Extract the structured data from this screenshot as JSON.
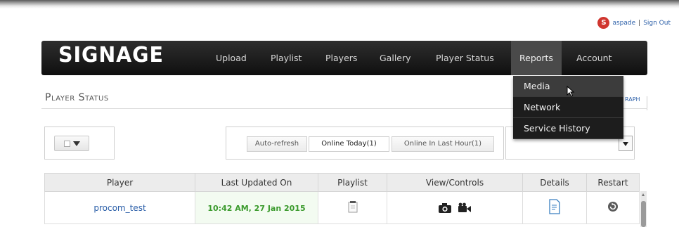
{
  "user": {
    "avatar_letter": "S",
    "username": "aspade",
    "separator": "|",
    "signout": "Sign Out"
  },
  "nav": {
    "logo": "SIGNAGE",
    "items": [
      "Upload",
      "Playlist",
      "Players",
      "Gallery",
      "Player Status",
      "Reports",
      "Account"
    ],
    "active": "Reports"
  },
  "dropdown": {
    "items": [
      "Media",
      "Network",
      "Service History"
    ],
    "hovered": "Media"
  },
  "page": {
    "title": "Player Status",
    "graph_link": "RAPH"
  },
  "filters": {
    "buttons": [
      "Auto-refresh",
      "Online Today(1)",
      "Online In Last Hour(1)"
    ],
    "active": "Online Today(1)"
  },
  "table": {
    "headers": [
      "Player",
      "Last Updated On",
      "Playlist",
      "View/Controls",
      "Details",
      "Restart"
    ],
    "rows": [
      {
        "player": "procom_test",
        "updated": "10:42 AM, 27 Jan 2015"
      }
    ]
  },
  "colors": {
    "nav_bg": "#1a1a1a",
    "link": "#2a5ea8",
    "updated_green": "#3a9a2c",
    "avatar_red": "#d0362f"
  },
  "icons": [
    "playlist-icon",
    "camera-icon",
    "video-camera-icon",
    "details-icon",
    "restart-icon",
    "mouse-cursor-icon"
  ]
}
